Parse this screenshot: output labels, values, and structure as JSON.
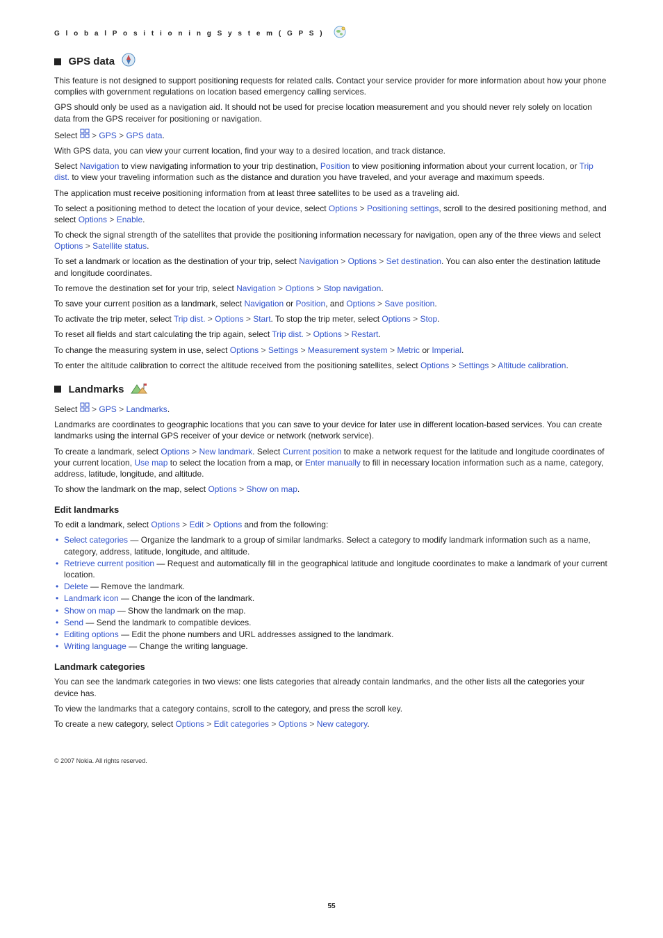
{
  "header": {
    "breadcrumb": "G l o b a l   P o s i t i o n i n g   S y s t e m   ( G P S )"
  },
  "sections": {
    "gps": {
      "title": "GPS data",
      "p1": "This feature is not designed to support positioning requests for related calls. Contact your service provider for more information about how your phone complies with government regulations on location based emergency calling services.",
      "p2": "GPS should only be used as a navigation aid. It should not be used for precise location measurement and you should never rely solely on location data from the GPS receiver for positioning or navigation.",
      "select_prefix": "Select ",
      "menu_gps": "GPS",
      "menu_gpsdata": "GPS data",
      "period": ".",
      "p3": "With GPS data, you can view your current location, find your way to a desired location, and track distance.",
      "p4a": "Select ",
      "navigation": "Navigation",
      "p4b": " to view navigating information to your trip destination, ",
      "position": "Position",
      "p4c": " to view positioning information about your current location, or ",
      "tripdist": "Trip dist.",
      "p4d": " to view your traveling information such as the distance and duration you have traveled, and your average and maximum speeds.",
      "p5": "The application must receive positioning information from at least three satellites to be used as a traveling aid.",
      "p6a": "To select a positioning method to detect the location of your device, select ",
      "options": "Options",
      "positioning_settings": "Positioning settings",
      "p6b": ", scroll to the desired positioning method, and select ",
      "enable": "Enable",
      "p7a": "To check the signal strength of the satellites that provide the positioning information necessary for navigation, open any of the three views and select ",
      "satellite_status": "Satellite status",
      "p8a": "To set a landmark or location as the destination of your trip, select ",
      "set_destination": "Set destination",
      "p8b": ". You can also enter the destination latitude and longitude coordinates.",
      "p9a": "To remove the destination set for your trip, select ",
      "stop_navigation": "Stop navigation",
      "p10a": "To save your current position as a landmark, select ",
      "p10b": " or ",
      "p10c": ", and ",
      "save_position": "Save position",
      "p11a": "To activate the trip meter, select ",
      "start": "Start",
      "p11b": ". To stop the trip meter, select ",
      "stop": "Stop",
      "p12a": "To reset all fields and start calculating the trip again, select ",
      "restart": "Restart",
      "p13a": "To change the measuring system in use, select ",
      "settings": "Settings",
      "measurement_system": "Measurement system",
      "metric": "Metric",
      "or": " or ",
      "imperial": "Imperial",
      "p14a": "To enter the altitude calibration to correct the altitude received from the positioning satellites, select ",
      "altitude_calibration": "Altitude calibration"
    },
    "landmarks": {
      "title": "Landmarks",
      "menu_landmarks": "Landmarks",
      "p1": "Landmarks are coordinates to geographic locations that you can save to your device for later use in different location-based services. You can create landmarks using the internal GPS receiver of your device or network (network service).",
      "p2a": "To create a landmark, select ",
      "new_landmark": "New landmark",
      "p2b": ". Select ",
      "current_position": "Current position",
      "p2c": " to make a network request for the latitude and longitude coordinates of your current location, ",
      "use_map": "Use map",
      "p2d": " to select the location from a map, or ",
      "enter_manually": "Enter manually",
      "p2e": " to fill in necessary location information such as a name, category, address, latitude, longitude, and altitude.",
      "p3a": "To show the landmark on the map, select ",
      "show_on_map": "Show on map"
    },
    "edit": {
      "title": "Edit landmarks",
      "intro_a": "To edit a landmark, select ",
      "edit": "Edit",
      "intro_b": " and from the following:",
      "items": [
        {
          "label": "Select categories",
          "text": " — Organize the landmark to a group of similar landmarks. Select a category to modify landmark information such as a name, category, address, latitude, longitude, and altitude."
        },
        {
          "label": "Retrieve current position",
          "text": " — Request and automatically fill in the geographical latitude and longitude coordinates to make a landmark of your current location."
        },
        {
          "label": "Delete",
          "text": " — Remove the landmark."
        },
        {
          "label": "Landmark icon",
          "text": " — Change the icon of the landmark."
        },
        {
          "label": "Show on map",
          "text": " — Show the landmark on the map."
        },
        {
          "label": "Send",
          "text": " — Send the landmark to compatible devices."
        },
        {
          "label": "Editing options",
          "text": " — Edit the phone numbers and URL addresses assigned to the landmark."
        },
        {
          "label": "Writing language",
          "text": " — Change the writing language."
        }
      ]
    },
    "categories": {
      "title": "Landmark categories",
      "p1": "You can see the landmark categories in two views: one lists categories that already contain landmarks, and the other lists all the categories your device has.",
      "p2": "To view the landmarks that a category contains, scroll to the category, and press the scroll key.",
      "p3a": "To create a new category, select ",
      "edit_categories": "Edit categories",
      "new_category": "New category"
    }
  },
  "footer": {
    "copyright": "© 2007 Nokia. All rights reserved.",
    "page": "55"
  },
  "glyphs": {
    "gt": ">"
  }
}
